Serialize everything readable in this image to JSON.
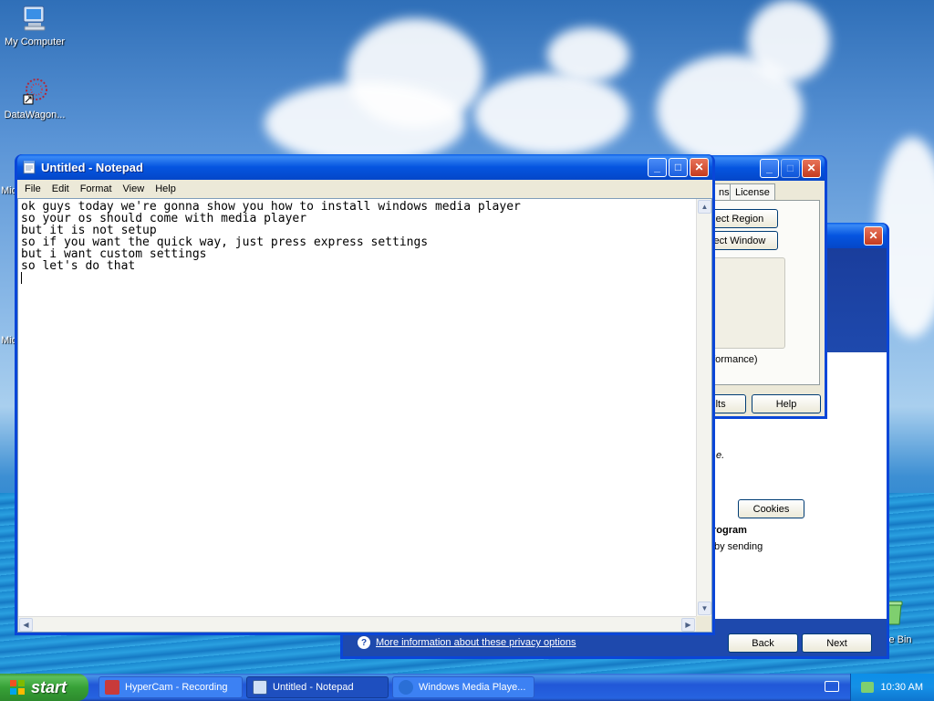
{
  "desktop": {
    "icons": [
      {
        "label": "My Computer"
      },
      {
        "label": "DataWagon..."
      },
      {
        "label": "Mic"
      },
      {
        "label": "Mic"
      },
      {
        "label": "le Bin"
      }
    ]
  },
  "notepad": {
    "title": "Untitled - Notepad",
    "menu": [
      "File",
      "Edit",
      "Format",
      "View",
      "Help"
    ],
    "content": "ok guys today we're gonna show you how to install windows media player\nso your os should come with media player\nbut it is not setup\nso if you want the quick way, just press express settings\nbut i want custom settings\nso let's do that"
  },
  "hypercam": {
    "tabs": [
      "ns",
      "License"
    ],
    "buttons": {
      "select_region": "Select Region",
      "select_window": "Select Window",
      "defaults": "aults",
      "help": "Help"
    },
    "note": "n performance)"
  },
  "wmp_setup": {
    "text_partial_1": "e.",
    "cookies_button": "Cookies",
    "heading_partial": "rogram",
    "text_partial_2": "by sending",
    "privacy_link": "More information about these privacy options",
    "back_button": "Back",
    "next_button": "Next"
  },
  "taskbar": {
    "start": "start",
    "tasks": [
      {
        "label": "HyperCam - Recording"
      },
      {
        "label": "Untitled - Notepad"
      },
      {
        "label": "Windows Media Playe..."
      }
    ],
    "clock": "10:30 AM"
  },
  "colors": {
    "xp_blue": "#0a46d8",
    "start_green": "#37a137"
  }
}
